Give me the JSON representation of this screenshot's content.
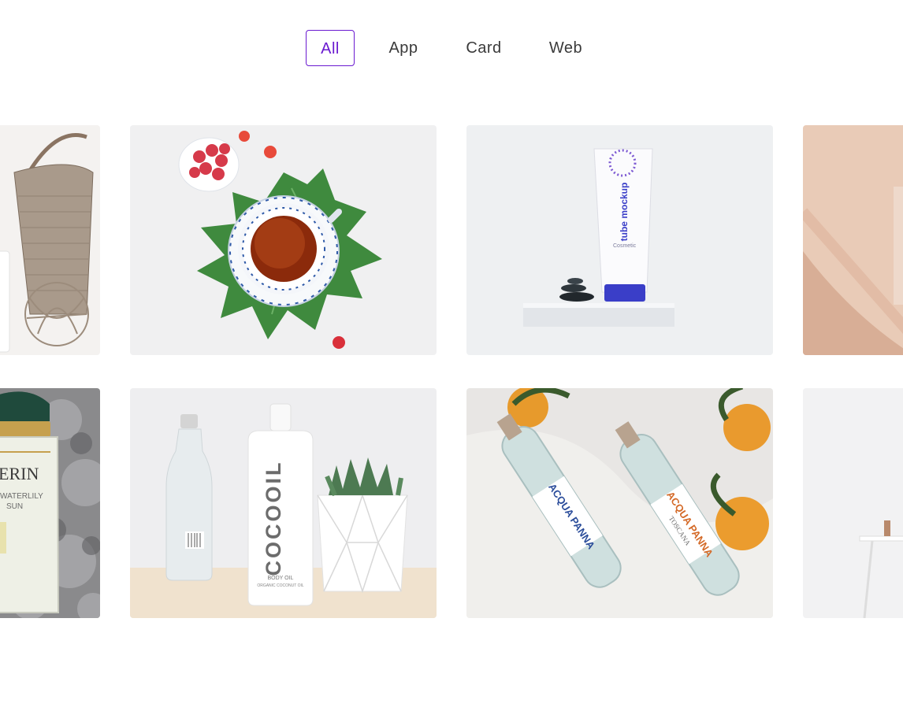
{
  "filters": {
    "items": [
      {
        "label": "All",
        "active": true
      },
      {
        "label": "App",
        "active": false
      },
      {
        "label": "Card",
        "active": false
      },
      {
        "label": "Web",
        "active": false
      }
    ],
    "accent_color": "#6a1ad0"
  },
  "gallery": {
    "items": [
      {
        "subject": "woven basket with glass bottle and driftwood ball"
      },
      {
        "subject": "tea cup on saucer over green leaf with raspberries"
      },
      {
        "subject": "cosmetic tube mockup on white pedestal with stones",
        "text": {
          "tube": "tube mockup",
          "brand": "Cosmetic"
        }
      },
      {
        "subject": "pink marble surface with glass object"
      },
      {
        "subject": "perfume bottle on grey fur",
        "text": {
          "name": "ERIN",
          "line1": "WATERLILY",
          "line2": "SUN"
        }
      },
      {
        "subject": "glass bottle, coconut oil bottle and succulent plant",
        "text": {
          "brand": "COCOOIL",
          "line1": "BODY OIL",
          "line2": "ORGANIC COCONUT OIL"
        }
      },
      {
        "subject": "Acqua Panna glass bottles with tangerines",
        "text": {
          "brand": "ACQUA PANNA",
          "region": "TOSCANA"
        }
      },
      {
        "subject": "white minimal interior with stool"
      }
    ]
  }
}
